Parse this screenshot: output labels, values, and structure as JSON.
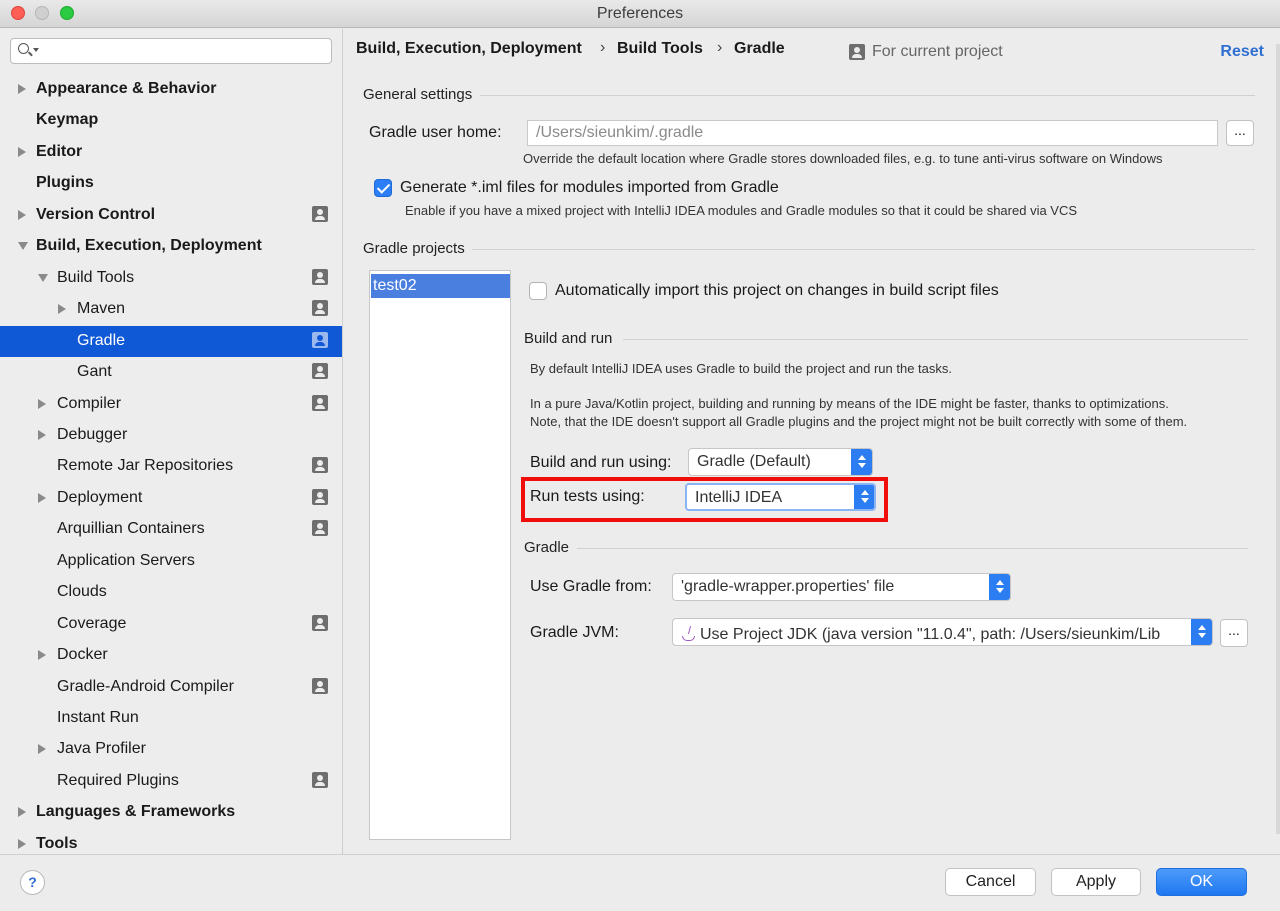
{
  "window": {
    "title": "Preferences"
  },
  "sidebar": {
    "search_placeholder": "",
    "items": [
      {
        "label": "Appearance & Behavior",
        "bold": true,
        "arrow": "right",
        "indent": 0,
        "proj": false
      },
      {
        "label": "Keymap",
        "bold": true,
        "arrow": "",
        "indent": 0,
        "proj": false
      },
      {
        "label": "Editor",
        "bold": true,
        "arrow": "right",
        "indent": 0,
        "proj": false
      },
      {
        "label": "Plugins",
        "bold": true,
        "arrow": "",
        "indent": 0,
        "proj": false
      },
      {
        "label": "Version Control",
        "bold": true,
        "arrow": "right",
        "indent": 0,
        "proj": true
      },
      {
        "label": "Build, Execution, Deployment",
        "bold": true,
        "arrow": "down",
        "indent": 0,
        "proj": false
      },
      {
        "label": "Build Tools",
        "bold": false,
        "arrow": "down",
        "indent": 1,
        "proj": true
      },
      {
        "label": "Maven",
        "bold": false,
        "arrow": "right",
        "indent": 2,
        "proj": true
      },
      {
        "label": "Gradle",
        "bold": false,
        "arrow": "",
        "indent": 2,
        "proj": true,
        "selected": true
      },
      {
        "label": "Gant",
        "bold": false,
        "arrow": "",
        "indent": 2,
        "proj": true
      },
      {
        "label": "Compiler",
        "bold": false,
        "arrow": "right",
        "indent": 1,
        "proj": true
      },
      {
        "label": "Debugger",
        "bold": false,
        "arrow": "right",
        "indent": 1,
        "proj": false
      },
      {
        "label": "Remote Jar Repositories",
        "bold": false,
        "arrow": "",
        "indent": 1,
        "proj": true
      },
      {
        "label": "Deployment",
        "bold": false,
        "arrow": "right",
        "indent": 1,
        "proj": true
      },
      {
        "label": "Arquillian Containers",
        "bold": false,
        "arrow": "",
        "indent": 1,
        "proj": true
      },
      {
        "label": "Application Servers",
        "bold": false,
        "arrow": "",
        "indent": 1,
        "proj": false
      },
      {
        "label": "Clouds",
        "bold": false,
        "arrow": "",
        "indent": 1,
        "proj": false
      },
      {
        "label": "Coverage",
        "bold": false,
        "arrow": "",
        "indent": 1,
        "proj": true
      },
      {
        "label": "Docker",
        "bold": false,
        "arrow": "right",
        "indent": 1,
        "proj": false
      },
      {
        "label": "Gradle-Android Compiler",
        "bold": false,
        "arrow": "",
        "indent": 1,
        "proj": true
      },
      {
        "label": "Instant Run",
        "bold": false,
        "arrow": "",
        "indent": 1,
        "proj": false
      },
      {
        "label": "Java Profiler",
        "bold": false,
        "arrow": "right",
        "indent": 1,
        "proj": false
      },
      {
        "label": "Required Plugins",
        "bold": false,
        "arrow": "",
        "indent": 1,
        "proj": true
      },
      {
        "label": "Languages & Frameworks",
        "bold": true,
        "arrow": "right",
        "indent": 0,
        "proj": false
      },
      {
        "label": "Tools",
        "bold": true,
        "arrow": "right",
        "indent": 0,
        "proj": false
      }
    ]
  },
  "header": {
    "breadcrumbs": [
      "Build, Execution, Deployment",
      "Build Tools",
      "Gradle"
    ],
    "separator": "›",
    "for_current_project": "For current project",
    "reset": "Reset"
  },
  "general": {
    "title": "General settings",
    "user_home_label": "Gradle user home:",
    "user_home_placeholder": "/Users/sieunkim/.gradle",
    "browse": "...",
    "user_home_hint": "Override the default location where Gradle stores downloaded files, e.g. to tune anti-virus software on Windows",
    "generate_iml_label": "Generate *.iml files for modules imported from Gradle",
    "generate_iml_hint": "Enable if you have a mixed project with IntelliJ IDEA modules and Gradle modules so that it could be shared via VCS"
  },
  "projects": {
    "title": "Gradle projects",
    "list": [
      "test02"
    ],
    "auto_import_label": "Automatically import this project on changes in build script files"
  },
  "build_run": {
    "title": "Build and run",
    "desc1": "By default IntelliJ IDEA uses Gradle to build the project and run the tasks.",
    "desc2": "In a pure Java/Kotlin project, building and running by means of the IDE might be faster, thanks to optimizations.",
    "desc3": "Note, that the IDE doesn't support all Gradle plugins and the project might not be built correctly with some of them.",
    "build_using_label": "Build and run using:",
    "build_using_value": "Gradle (Default)",
    "tests_using_label": "Run tests using:",
    "tests_using_value": "IntelliJ IDEA"
  },
  "gradle": {
    "title": "Gradle",
    "use_from_label": "Use Gradle from:",
    "use_from_value": "'gradle-wrapper.properties' file",
    "jvm_label": "Gradle JVM:",
    "jvm_value": "Use Project JDK (java version \"11.0.4\", path: /Users/sieunkim/Lib",
    "jvm_browse": "..."
  },
  "footer": {
    "help": "?",
    "cancel": "Cancel",
    "apply": "Apply",
    "ok": "OK"
  },
  "colors": {
    "selection": "#0f58d6",
    "accent": "#2c7cf2",
    "highlight": "#f20d0d"
  }
}
